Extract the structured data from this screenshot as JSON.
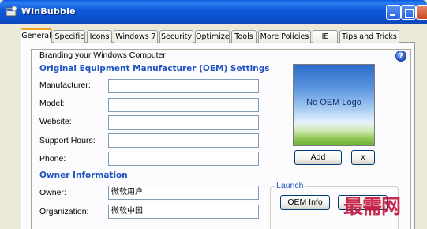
{
  "window": {
    "title": "WinBubble"
  },
  "tabs": [
    "General",
    "Specific",
    "Icons",
    "Windows 7",
    "Security",
    "Optimize",
    "Tools",
    "More Policies",
    "IE",
    "Tips and Tricks"
  ],
  "active_tab": "General",
  "group": {
    "title": "Branding your Windows Computer"
  },
  "oem": {
    "heading": "Original Equipment Manufacturer (OEM) Settings",
    "manufacturer_label": "Manufacturer:",
    "manufacturer_value": "",
    "model_label": "Model:",
    "model_value": "",
    "website_label": "Website:",
    "website_value": "",
    "support_hours_label": "Support Hours:",
    "support_hours_value": "",
    "phone_label": "Phone:",
    "phone_value": ""
  },
  "owner": {
    "heading": "Owner Information",
    "owner_label": "Owner:",
    "owner_value": "微软用户",
    "organization_label": "Organization:",
    "organization_value": "微软中国"
  },
  "logo": {
    "placeholder": "No OEM Logo",
    "add_label": "Add",
    "remove_label": "x"
  },
  "launch": {
    "label": "Launch",
    "oem_info_label": "OEM Info",
    "second_button_label": ""
  },
  "watermark": {
    "text": "最需网"
  },
  "icons": {
    "app": "winbubble-app-icon",
    "help": "help-icon",
    "minimize": "minimize-icon",
    "maximize": "maximize-icon",
    "close": "close-icon"
  },
  "colors": {
    "titlebar": "#0a4fcb",
    "heading": "#1f53c1",
    "active_tab_accent": "#f5a623",
    "watermark": "#c3173e"
  }
}
